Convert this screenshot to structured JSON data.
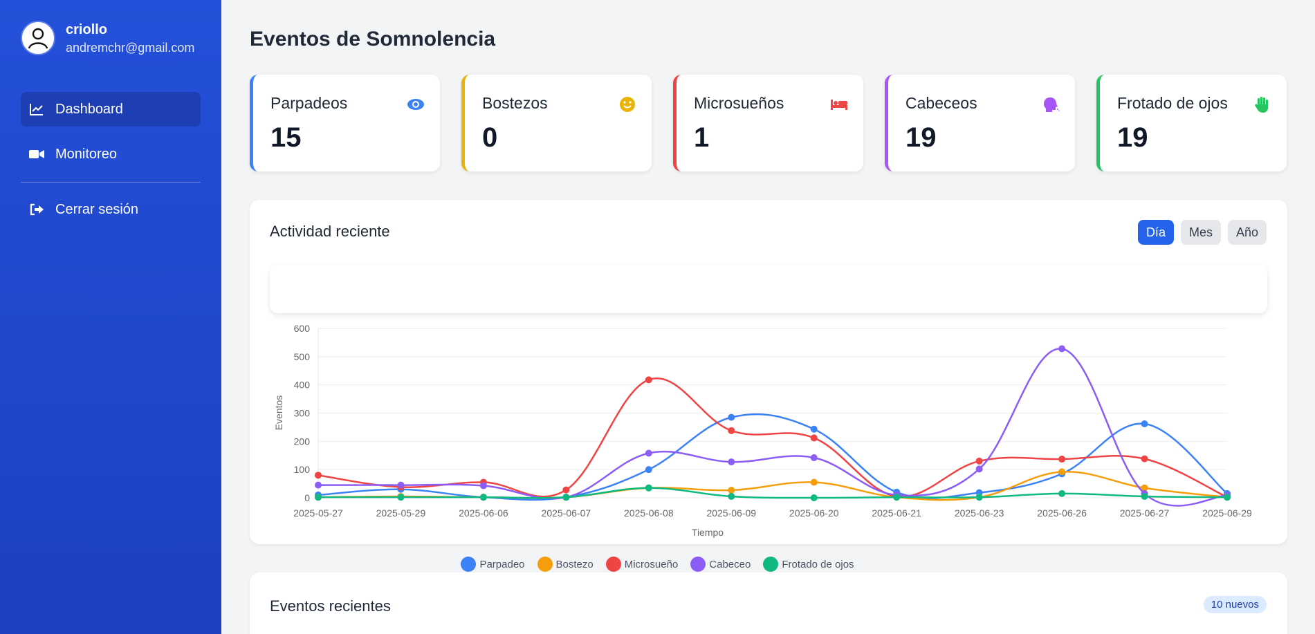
{
  "user": {
    "name": "criollo",
    "email": "andremchr@gmail.com"
  },
  "nav": [
    {
      "label": "Dashboard",
      "icon": "chart-line-icon",
      "active": true
    },
    {
      "label": "Monitoreo",
      "icon": "video-camera-icon",
      "active": false
    },
    {
      "label": "Cerrar sesión",
      "icon": "logout-icon",
      "active": false
    }
  ],
  "page_title": "Eventos de Somnolencia",
  "cards": [
    {
      "title": "Parpadeos",
      "value": "15",
      "color": "#3b82f6",
      "icon": "eye-icon"
    },
    {
      "title": "Bostezos",
      "value": "0",
      "color": "#eab308",
      "icon": "smile-icon"
    },
    {
      "title": "Microsueños",
      "value": "1",
      "color": "#ef4444",
      "icon": "bed-icon"
    },
    {
      "title": "Cabeceos",
      "value": "19",
      "color": "#a855f7",
      "icon": "head-side-icon"
    },
    {
      "title": "Frotado de ojos",
      "value": "19",
      "color": "#22c55e",
      "icon": "hand-icon"
    }
  ],
  "activity": {
    "title": "Actividad reciente",
    "toggles": [
      {
        "label": "Día",
        "active": true
      },
      {
        "label": "Mes",
        "active": false
      },
      {
        "label": "Año",
        "active": false
      }
    ]
  },
  "recent_events": {
    "title": "Eventos recientes",
    "badge": "10 nuevos"
  },
  "chart_data": {
    "type": "line",
    "xlabel": "Tiempo",
    "ylabel": "Eventos",
    "ylim": [
      0,
      600
    ],
    "yticks": [
      0,
      100,
      200,
      300,
      400,
      500,
      600
    ],
    "grid": true,
    "legend_position": "bottom",
    "categories": [
      "2025-05-27",
      "2025-05-29",
      "2025-06-06",
      "2025-06-07",
      "2025-06-08",
      "2025-06-09",
      "2025-06-20",
      "2025-06-21",
      "2025-06-23",
      "2025-06-26",
      "2025-06-27",
      "2025-06-29"
    ],
    "series": [
      {
        "name": "Parpadeo",
        "color": "#3b82f6",
        "values": [
          10,
          30,
          2,
          2,
          100,
          285,
          243,
          20,
          18,
          85,
          262,
          15
        ]
      },
      {
        "name": "Bostezo",
        "color": "#f59e0b",
        "values": [
          2,
          5,
          2,
          2,
          35,
          27,
          55,
          2,
          2,
          92,
          35,
          2
        ]
      },
      {
        "name": "Microsueño",
        "color": "#ef4444",
        "values": [
          80,
          38,
          55,
          28,
          418,
          238,
          212,
          5,
          130,
          137,
          138,
          2
        ]
      },
      {
        "name": "Cabeceo",
        "color": "#8b5cf6",
        "values": [
          45,
          45,
          43,
          2,
          158,
          127,
          142,
          10,
          102,
          528,
          15,
          8
        ]
      },
      {
        "name": "Frotado de ojos",
        "color": "#10b981",
        "values": [
          2,
          2,
          2,
          2,
          35,
          5,
          0,
          2,
          2,
          15,
          5,
          2
        ]
      }
    ]
  }
}
